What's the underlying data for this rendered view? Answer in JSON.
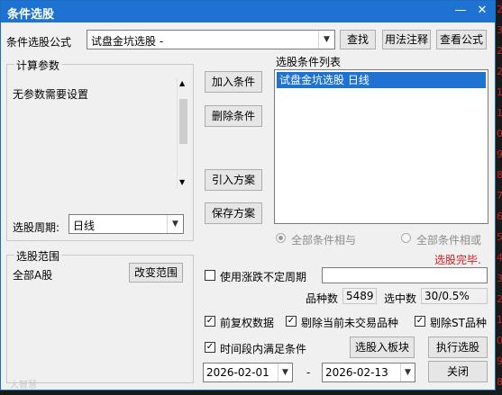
{
  "window": {
    "title": "条件选股"
  },
  "formula": {
    "label": "条件选股公式",
    "value": "试盘金坑选股  -"
  },
  "buttons": {
    "find": "查找",
    "usage": "用法注释",
    "view_formula": "查看公式",
    "add_condition": "加入条件",
    "delete_condition": "删除条件",
    "import_plan": "引入方案",
    "save_plan": "保存方案",
    "change_range": "改变范围",
    "to_block": "选股入板块",
    "execute": "执行选股",
    "close": "关闭"
  },
  "params": {
    "legend": "计算参数",
    "text": "无参数需要设置"
  },
  "period": {
    "label": "选股周期:",
    "value": "日线"
  },
  "conditions": {
    "legend": "选股条件列表",
    "items": [
      "试盘金坑选股  日线"
    ]
  },
  "logic": {
    "all_and": "全部条件相与",
    "all_or": "全部条件相或",
    "status": "选股完毕."
  },
  "range": {
    "legend": "选股范围",
    "value": "全部A股"
  },
  "options": {
    "use_unfixed_period": "使用涨跌不定周期",
    "pre_adjust": "前复权数据",
    "exclude_untraded": "剔除当前未交易品种",
    "exclude_st": "剔除ST品种",
    "period_satisfy": "时间段内满足条件"
  },
  "stats": {
    "count_label": "品种数",
    "count_value": "5489",
    "selected_label": "选中数",
    "selected_value": "30/0.5%"
  },
  "dates": {
    "start": "2026-02-01",
    "sep": "-",
    "end": "2026-02-13"
  },
  "watermark": "大智慧",
  "side_numbers": [
    "2",
    "3",
    "2",
    "2",
    "1",
    "1",
    "0",
    "9",
    "8",
    "7",
    "6",
    "5",
    "4",
    "3",
    "2",
    "1",
    "0",
    "9",
    "8"
  ],
  "colors": {
    "titlebar": "#1e73d2",
    "selection": "#1e73d2",
    "status": "#d02020"
  }
}
